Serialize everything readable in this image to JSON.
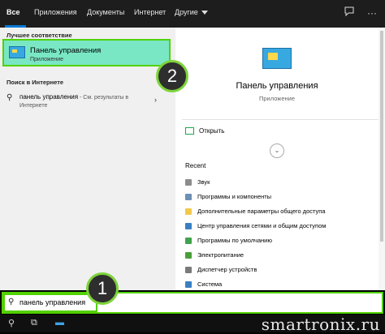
{
  "tabs": [
    {
      "label": "Все"
    },
    {
      "label": "Приложения"
    },
    {
      "label": "Документы"
    },
    {
      "label": "Интернет"
    },
    {
      "label": "Другие"
    }
  ],
  "left": {
    "best_match_heading": "Лучшее соответствие",
    "best_match": {
      "title": "Панель управления",
      "subtitle": "Приложение"
    },
    "web_heading": "Поиск в Интернете",
    "web_result": {
      "query": "панель управления",
      "hint": " - См. результаты в",
      "sub": "Интернете"
    }
  },
  "right": {
    "title": "Панель управления",
    "type": "Приложение",
    "open_label": "Открыть",
    "recent_heading": "Recent",
    "recent": [
      {
        "label": "Звук",
        "icon": "speaker-icon",
        "color": "#8c8c8c"
      },
      {
        "label": "Программы и компоненты",
        "icon": "programs-icon",
        "color": "#6d8fb3"
      },
      {
        "label": "Дополнительные параметры общего доступа",
        "icon": "folder-icon",
        "color": "#f2c94c"
      },
      {
        "label": "Центр управления сетями и общим доступом",
        "icon": "network-icon",
        "color": "#3a7fc1"
      },
      {
        "label": "Программы по умолчанию",
        "icon": "default-programs-icon",
        "color": "#3fa34d"
      },
      {
        "label": "Электропитание",
        "icon": "power-icon",
        "color": "#4a9e3a"
      },
      {
        "label": "Диспетчер устройств",
        "icon": "device-manager-icon",
        "color": "#7a7a7a"
      },
      {
        "label": "Система",
        "icon": "system-icon",
        "color": "#3a7fc1"
      }
    ]
  },
  "search": {
    "value": "панель управления"
  },
  "badges": {
    "one": "1",
    "two": "2"
  },
  "watermark": "smartronix.ru"
}
